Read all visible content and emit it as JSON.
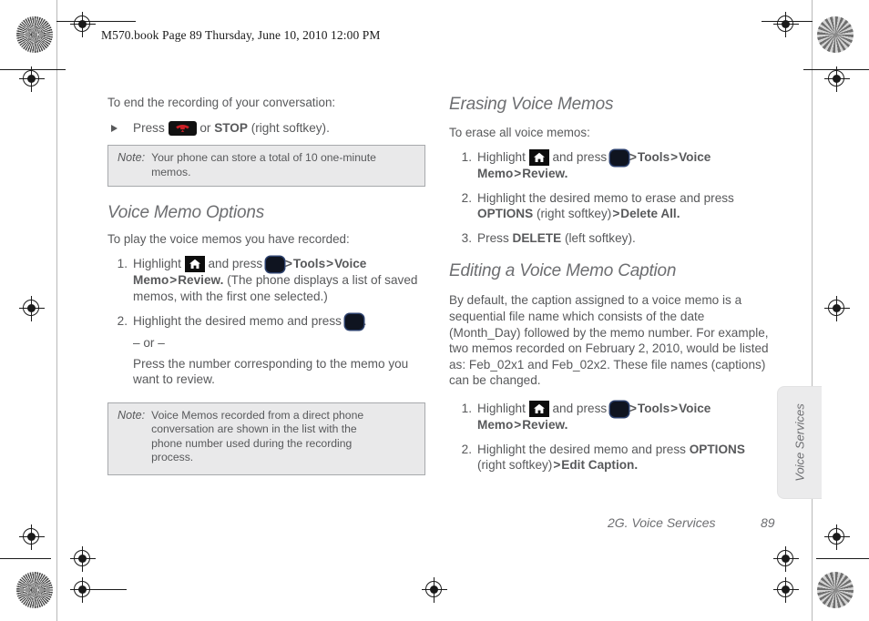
{
  "running_head": "M570.book  Page 89  Thursday, June 10, 2010  12:00 PM",
  "left_column": {
    "intro": "To end the recording of your conversation:",
    "arrow_step": {
      "press": "Press",
      "or": "or",
      "stop": "STOP",
      "softkey": "(right softkey)."
    },
    "note1": {
      "label": "Note:",
      "text": "Your phone can store a total of 10 one-minute memos."
    },
    "heading": "Voice Memo Options",
    "lead": "To play the voice memos you have recorded:",
    "step1": {
      "num": "1.",
      "highlight": "Highlight",
      "and_press": "and press",
      "gt1": ">",
      "tools": "Tools",
      "gt2": ">",
      "voice_memo": "Voice Memo",
      "gt3": ">",
      "review": "Review.",
      "tail": "(The phone displays a list of saved memos, with the first one selected.)"
    },
    "step2": {
      "num": "2.",
      "text": "Highlight the desired memo and press",
      "period": "."
    },
    "or_line": "– or –",
    "or_text": "Press the number corresponding to the memo you want to review.",
    "note2": {
      "label": "Note:",
      "text": "Voice Memos recorded from a direct phone conversation are shown in the list with the phone number used during the recording process."
    }
  },
  "right_column": {
    "heading1": "Erasing Voice Memos",
    "lead1": "To erase all voice memos:",
    "erase_step1": {
      "num": "1.",
      "highlight": "Highlight",
      "and_press": "and press",
      "gt1": ">",
      "tools": "Tools",
      "gt2": ">",
      "voice_memo": "Voice Memo",
      "gt3": ">",
      "review": "Review."
    },
    "erase_step2": {
      "num": "2.",
      "text": "Highlight the desired memo to erase and press",
      "options": "OPTIONS",
      "softkey": "(right softkey)",
      "gt": ">",
      "delete_all": "Delete All."
    },
    "erase_step3": {
      "num": "3.",
      "press": "Press",
      "delete": "DELETE",
      "softkey": "(left softkey)."
    },
    "heading2": "Editing a Voice Memo Caption",
    "paragraph": "By default, the caption assigned to a voice memo is a sequential file name which consists of the date (Month_Day) followed by the memo number. For example, two memos recorded on February 2, 2010, would be listed as: Feb_02x1 and Feb_02x2. These file names (captions) can be changed.",
    "edit_step1": {
      "num": "1.",
      "highlight": "Highlight",
      "and_press": "and press",
      "gt1": ">",
      "tools": "Tools",
      "gt2": ">",
      "voice_memo": "Voice Memo",
      "gt3": ">",
      "review": "Review."
    },
    "edit_step2": {
      "num": "2.",
      "text": "Highlight the desired memo and press",
      "options": "OPTIONS",
      "softkey": "(right softkey)",
      "gt": ">",
      "edit_caption": "Edit Caption."
    }
  },
  "side_tab": {
    "label": "Voice Services"
  },
  "footer": {
    "chapter": "2G. Voice Services",
    "page": "89"
  },
  "icons": {
    "home_key": "home-key-icon",
    "nav_key": "navigation-ok-key-icon",
    "end_key": "end-call-key-icon"
  },
  "colors": {
    "text": "#58595b",
    "note_bg": "#e9e9ea",
    "note_border": "#a7a9ac",
    "tab_bg": "#ebebec",
    "end_key_red": "#cc2026"
  }
}
